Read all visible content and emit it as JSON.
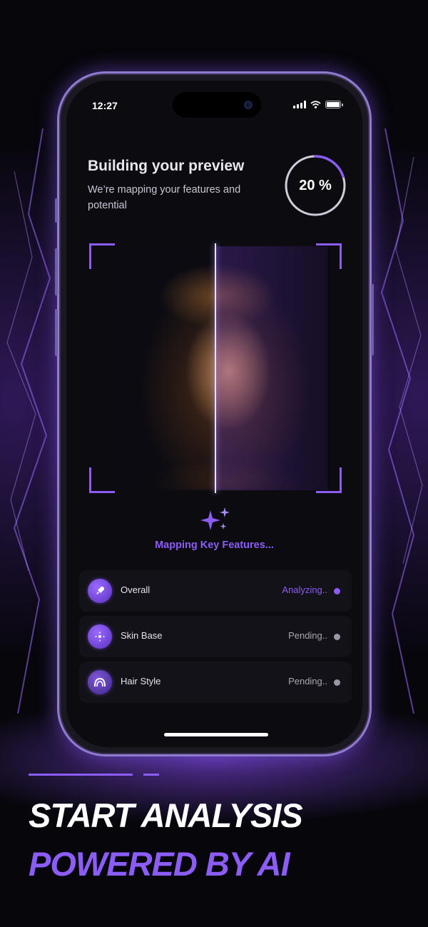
{
  "status_bar": {
    "time": "12:27"
  },
  "header": {
    "title": "Building your preview",
    "subtitle": "We’re mapping your features and potential",
    "progress_label": "20 %",
    "progress_fraction": 0.2
  },
  "scan": {
    "caption": "Mapping Key Features..."
  },
  "checklist": [
    {
      "label": "Overall",
      "status": "Analyzing..",
      "status_color": "#8b5cf6",
      "dot_color": "#8b5cf6",
      "icon": "rocket-icon"
    },
    {
      "label": "Skin Base",
      "status": "Pending..",
      "status_color": "#a9a6b2",
      "dot_color": "#9b98a4",
      "icon": "sparkle-dots-icon"
    },
    {
      "label": "Hair Style",
      "status": "Pending..",
      "status_color": "#a9a6b2",
      "dot_color": "#9b98a4",
      "icon": "hair-icon"
    }
  ],
  "promo": {
    "line1": "START ANALYSIS",
    "line2": "POWERED BY AI"
  },
  "colors": {
    "accent": "#8b5cf6",
    "background": "#07060b"
  }
}
